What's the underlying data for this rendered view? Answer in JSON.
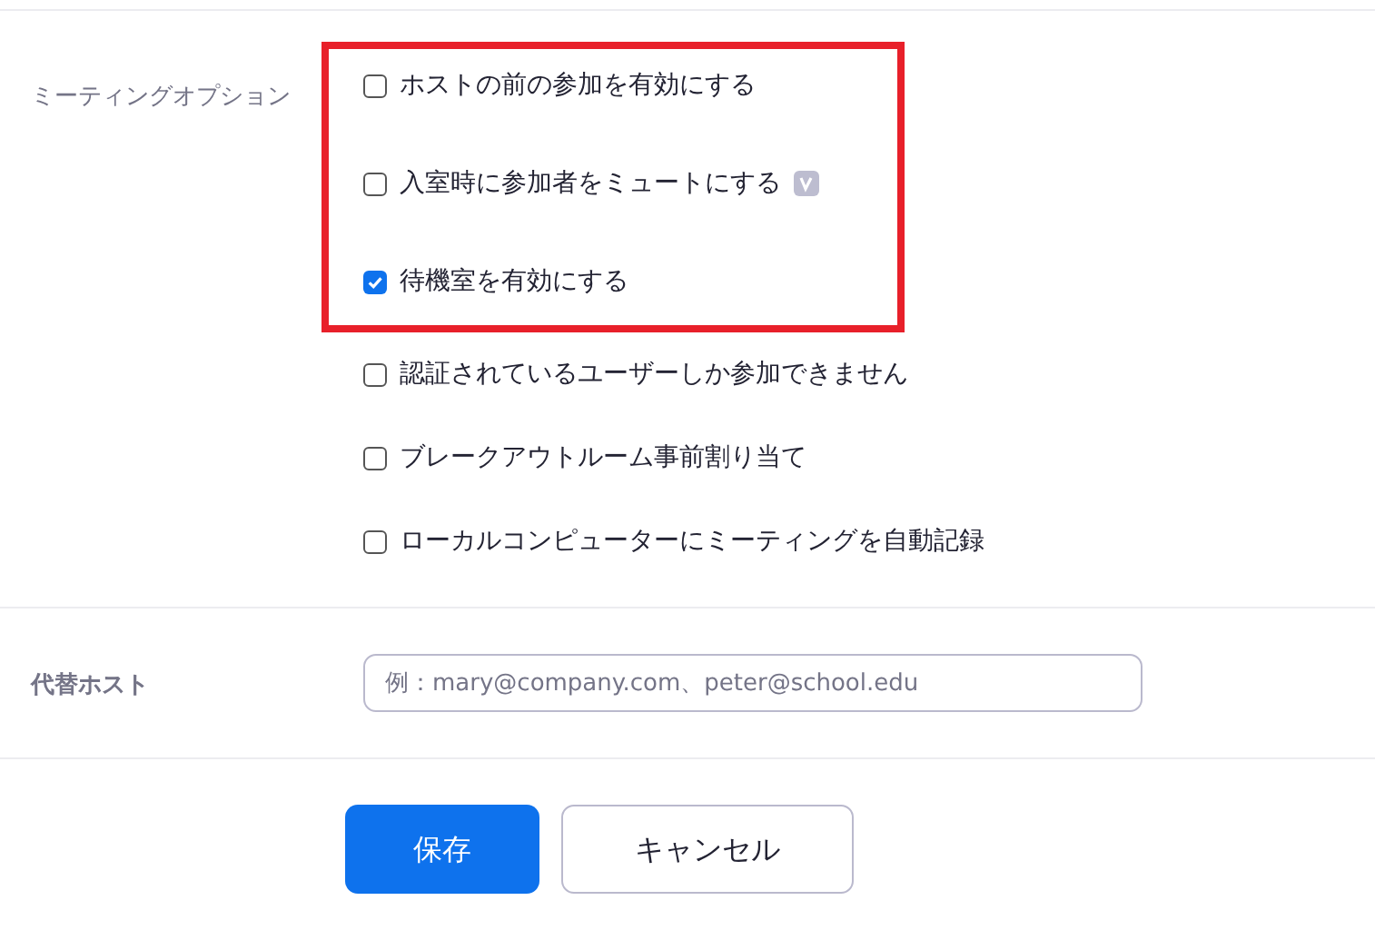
{
  "meeting_options": {
    "label": "ミーティングオプション",
    "options": [
      {
        "label": "ホストの前の参加を有効にする",
        "checked": false,
        "highlighted": true,
        "badge": false
      },
      {
        "label": "入室時に参加者をミュートにする",
        "checked": false,
        "highlighted": true,
        "badge": true
      },
      {
        "label": "待機室を有効にする",
        "checked": true,
        "highlighted": true,
        "badge": false
      },
      {
        "label": "認証されているユーザーしか参加できません",
        "checked": false,
        "highlighted": false,
        "badge": false
      },
      {
        "label": "ブレークアウトルーム事前割り当て",
        "checked": false,
        "highlighted": false,
        "badge": false
      },
      {
        "label": "ローカルコンピューターにミーティングを自動記録",
        "checked": false,
        "highlighted": false,
        "badge": false
      }
    ]
  },
  "alternative_host": {
    "label": "代替ホスト",
    "placeholder": "例：mary@company.com、peter@school.edu"
  },
  "buttons": [
    {
      "label": "保存",
      "kind": "primary"
    },
    {
      "label": "キャンセル",
      "kind": "secondary"
    }
  ]
}
